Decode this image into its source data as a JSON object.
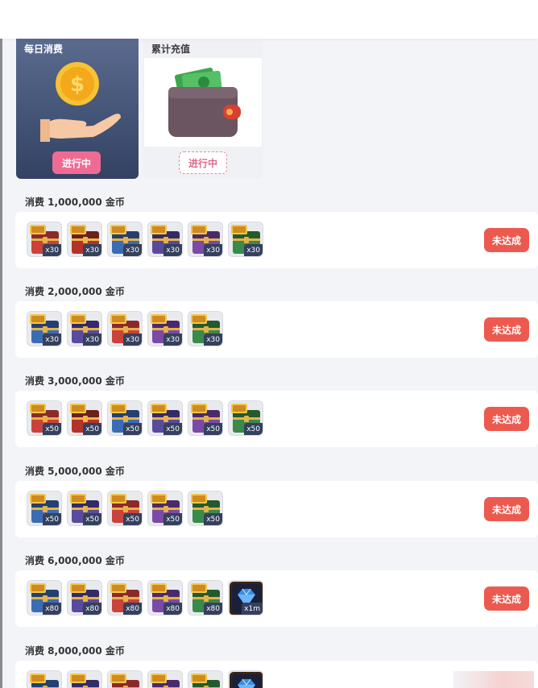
{
  "tabs": [
    {
      "title": "每日消费",
      "button": "进行中",
      "icon": "coin-hand-icon"
    },
    {
      "title": "累计充值",
      "button": "进行中",
      "icon": "wallet-icon"
    }
  ],
  "colors": {
    "claim": "#ec5a4f",
    "qty_badge": "#34405e",
    "tab_active": "#3e4d70",
    "pink_button": "#f06b93"
  },
  "tiers": [
    {
      "label": "消费 1,000,000 金币",
      "status": "未达成",
      "items": [
        {
          "icon": "scroll-chest-icon",
          "qty": "x30"
        },
        {
          "icon": "red-chest-icon",
          "qty": "x30"
        },
        {
          "icon": "blue-chest-icon",
          "qty": "x30"
        },
        {
          "icon": "purple-chest-icon",
          "qty": "x30"
        },
        {
          "icon": "violet-chest-icon",
          "qty": "x30"
        },
        {
          "icon": "green-chest-icon",
          "qty": "x30"
        }
      ]
    },
    {
      "label": "消费 2,000,000 金币",
      "status": "未达成",
      "items": [
        {
          "icon": "blue-chest-icon",
          "qty": "x30"
        },
        {
          "icon": "purple-chest-icon",
          "qty": "x30"
        },
        {
          "icon": "scroll-chest-icon",
          "qty": "x30"
        },
        {
          "icon": "violet-chest-icon",
          "qty": "x30"
        },
        {
          "icon": "green-chest-icon",
          "qty": "x30"
        }
      ]
    },
    {
      "label": "消费 3,000,000 金币",
      "status": "未达成",
      "items": [
        {
          "icon": "scroll-chest-icon",
          "qty": "x50"
        },
        {
          "icon": "red-chest-icon",
          "qty": "x50"
        },
        {
          "icon": "blue-chest-icon",
          "qty": "x50"
        },
        {
          "icon": "purple-chest-icon",
          "qty": "x50"
        },
        {
          "icon": "violet-chest-icon",
          "qty": "x50"
        },
        {
          "icon": "green-chest-icon",
          "qty": "x50"
        }
      ]
    },
    {
      "label": "消费 5,000,000 金币",
      "status": "未达成",
      "items": [
        {
          "icon": "blue-chest-icon",
          "qty": "x50"
        },
        {
          "icon": "purple-chest-icon",
          "qty": "x50"
        },
        {
          "icon": "scroll-chest-icon",
          "qty": "x50"
        },
        {
          "icon": "violet-chest-icon",
          "qty": "x50"
        },
        {
          "icon": "green-chest-icon",
          "qty": "x50"
        }
      ]
    },
    {
      "label": "消费 6,000,000 金币",
      "status": "未达成",
      "items": [
        {
          "icon": "blue-chest-icon",
          "qty": "x80"
        },
        {
          "icon": "purple-chest-icon",
          "qty": "x80"
        },
        {
          "icon": "scroll-chest-icon",
          "qty": "x80"
        },
        {
          "icon": "violet-chest-icon",
          "qty": "x80"
        },
        {
          "icon": "green-chest-icon",
          "qty": "x80"
        },
        {
          "icon": "diamond-icon",
          "qty": "x1m"
        }
      ]
    },
    {
      "label": "消费 8,000,000 金币",
      "status": "",
      "items": [
        {
          "icon": "blue-chest-icon",
          "qty": ""
        },
        {
          "icon": "purple-chest-icon",
          "qty": ""
        },
        {
          "icon": "scroll-chest-icon",
          "qty": ""
        },
        {
          "icon": "violet-chest-icon",
          "qty": ""
        },
        {
          "icon": "green-chest-icon",
          "qty": ""
        },
        {
          "icon": "diamond-icon",
          "qty": ""
        }
      ]
    }
  ]
}
